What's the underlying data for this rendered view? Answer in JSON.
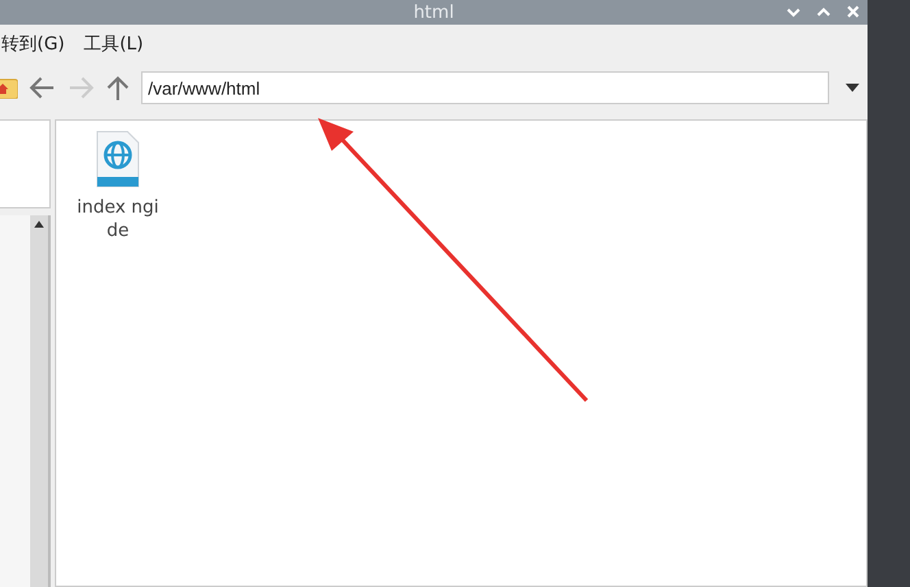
{
  "window": {
    "title": "html"
  },
  "menu": [
    {
      "label": "转到(G)"
    },
    {
      "label": "工具(L)"
    }
  ],
  "toolbar": {
    "path": "/var/www/html"
  },
  "files": [
    {
      "lines": [
        "index ngi",
        "de"
      ]
    }
  ]
}
